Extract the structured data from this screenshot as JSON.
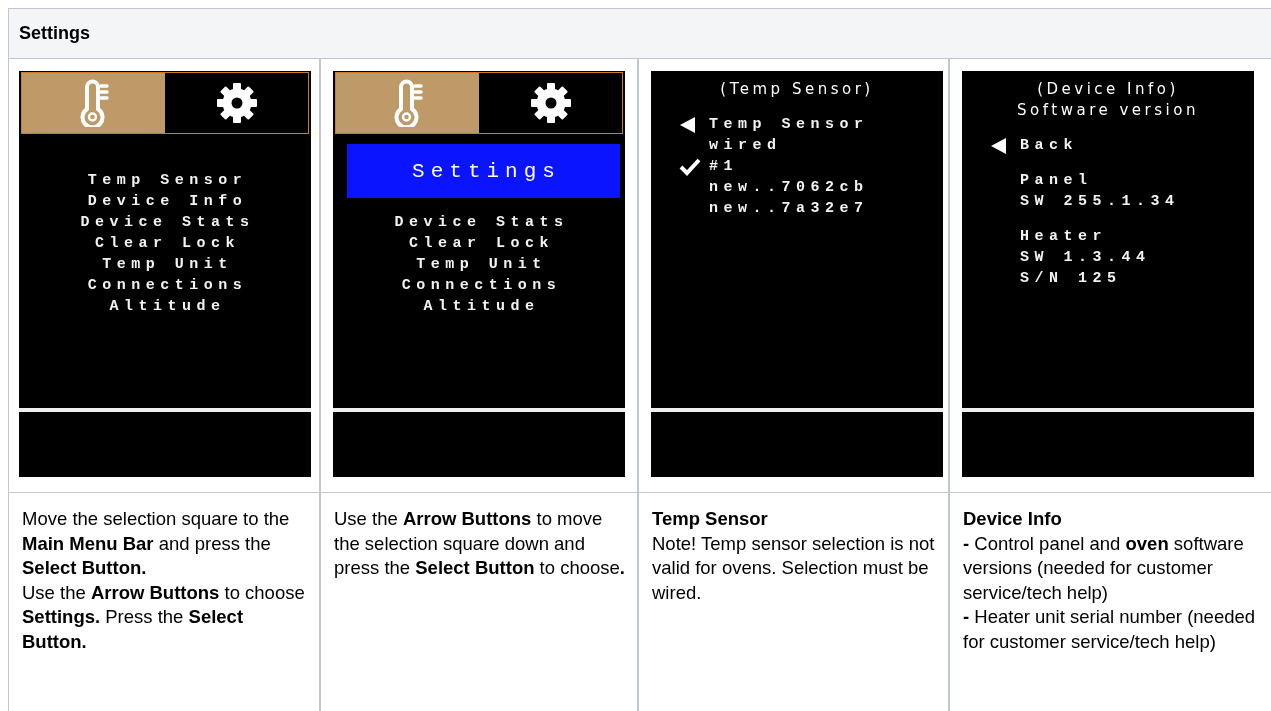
{
  "table": {
    "header": "Settings",
    "columns": [
      {
        "screen": {
          "kind": "menu",
          "tabs": [
            {
              "selected": true
            },
            {
              "selected": false
            }
          ],
          "items": [
            "Temp Sensor",
            "Device Info",
            "Device Stats",
            "Clear Lock",
            "Temp Unit",
            "Connections",
            "Altitude"
          ]
        },
        "description": {
          "paragraphs": [
            "Move the selection square to the **Main Menu Bar** and press the **Select Button.**",
            "Use the **Arrow Buttons** to choose **Settings.** Press the **Select Button.**"
          ]
        }
      },
      {
        "screen": {
          "kind": "menu",
          "tabs": [
            {
              "selected": true
            },
            {
              "selected": false
            }
          ],
          "popup": "Settings",
          "items": [
            "Device Stats",
            "Clear Lock",
            "Temp Unit",
            "Connections",
            "Altitude"
          ]
        },
        "description": {
          "paragraphs": [
            "Use the **Arrow Buttons** to move the selection square down and press the **Select Button** to choose**.**"
          ]
        }
      },
      {
        "screen": {
          "kind": "detail",
          "title_lines": [
            "(Temp Sensor)"
          ],
          "groups": [
            [
              {
                "kind": "back",
                "text": "Temp Sensor"
              },
              {
                "kind": "text",
                "text": "wired"
              },
              {
                "kind": "option",
                "text": "#1",
                "checked": true
              },
              {
                "kind": "option",
                "text": "new..7062cb",
                "checked": false
              },
              {
                "kind": "option",
                "text": "new..7a32e7",
                "checked": false
              }
            ]
          ]
        },
        "description": {
          "heading": "Temp Sensor",
          "paragraphs": [
            "Note! Temp sensor selection is not valid for ovens. Selection must be wired."
          ]
        }
      },
      {
        "screen": {
          "kind": "detail",
          "title_lines": [
            "(Device Info)",
            "Software version"
          ],
          "groups": [
            [
              {
                "kind": "back",
                "text": "Back"
              }
            ],
            [
              {
                "kind": "text",
                "text": "Panel"
              },
              {
                "kind": "text",
                "text": "SW 255.1.34"
              }
            ],
            [
              {
                "kind": "text",
                "text": "Heater"
              },
              {
                "kind": "text",
                "text": "SW 1.3.44"
              },
              {
                "kind": "text",
                "text": "S/N 125"
              }
            ]
          ]
        },
        "description": {
          "heading": "Device Info",
          "paragraphs": [
            "**-** Control panel and **oven** software versions (needed for customer service/tech help)",
            "**-** Heater unit serial number (needed for customer service/tech help)"
          ]
        }
      }
    ]
  }
}
